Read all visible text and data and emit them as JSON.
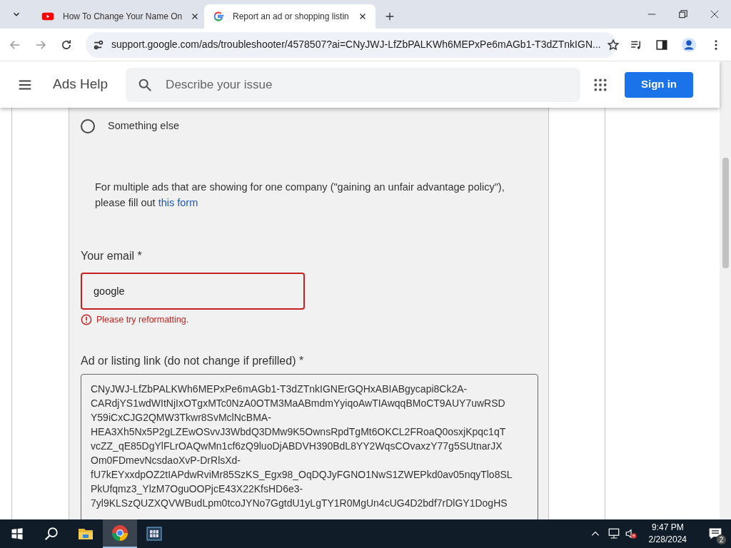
{
  "browser": {
    "tabs": [
      {
        "title": "How To Change Your Name On",
        "selected": false
      },
      {
        "title": "Report an ad or shopping listin",
        "selected": true
      }
    ],
    "url": "support.google.com/ads/troubleshooter/4578507?ai=CNyJWJ-LfZbPALKWh6MEPxPe6mAGb1-T3dZTnkIGN..."
  },
  "header": {
    "title": "Ads Help",
    "search": {
      "placeholder": "Describe your issue"
    },
    "sign_in": "Sign in"
  },
  "form": {
    "options": [
      {
        "label": "Something else",
        "selected": false
      }
    ],
    "note": "For multiple ads that are showing for one company (\"gaining an unfair advantage policy\"),",
    "note_line2": "please fill out",
    "note_link": "this form",
    "email": {
      "label": "Your email *",
      "value": "google",
      "invalid": true,
      "error": "Please try reformatting."
    },
    "link": {
      "label": "Ad or listing link (do not change if prefilled) *",
      "lines": [
        "CNyJWJ-LfZbPALKWh6MEPxPe6mAGb1-T3dZTnkIGNErGQHxABIABgycapi8Ck2A-",
        "CARdjYS1wdWItNjIxOTgxMTc0NzA0OTM3MaABmdmYyiqoAwTIAwqqBMoCT9AUY7uwRSD",
        "Y59iCxCJG2QMW3Tkwr8SvMclNcBMA-",
        "HEA3Xh5Nx5P2gLZEwOSvvJ3WbdQ3DMw9K5OwnsRpdTgMt6OKCL2FRoaQ0osxjKpqc1qT",
        "vcZZ_qE85DgYlFLrOAQwMn1cf6zQ9luoDjABDVH390BdL8YY2WqsCOvaxzY77g5SUtnarJX",
        "Om0FDmevNcsdaoXvP-DrRlsXd-",
        "fU7kEYxxdpOZ2tIAPdwRviMr85SzKS_Egx98_OqDQJyFGNO1NwS1ZWEPkd0av05nqyTlo8SL",
        "PkUfqmz3_YlzM7OguOOPjcE43X22KfsHD6e3-",
        "7yl9KLSzQUZXQVWBudLpm0tcoJYNo7GgtdU1yLgTY1R0MgUn4cUG4D2bdf7rDlGY1DogHS"
      ]
    }
  },
  "taskbar": {
    "apps": [
      {
        "kind": "explorer",
        "selected": false
      },
      {
        "kind": "chrome",
        "selected": true
      },
      {
        "kind": "video",
        "selected": false
      }
    ],
    "time": "9:47 PM",
    "date": "2/28/2024",
    "notifications": "2"
  }
}
